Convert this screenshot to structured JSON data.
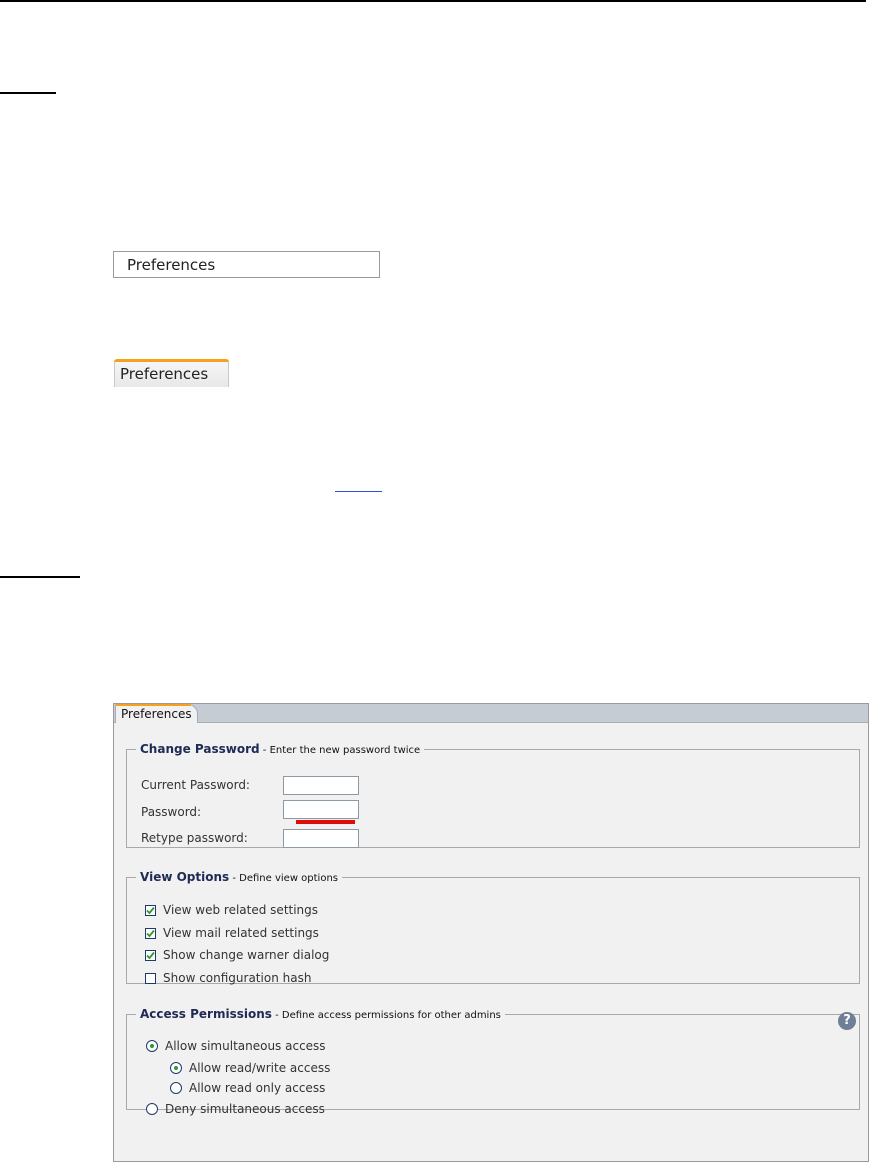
{
  "menu": {
    "label": "Preferences"
  },
  "tab": {
    "label": "Preferences"
  },
  "dialog": {
    "tab_label": "Preferences",
    "change_password": {
      "title": "Change Password",
      "subtitle": "- Enter the new password twice",
      "current_label": "Current Password:",
      "password_label": "Password:",
      "retype_label": "Retype password:",
      "current_value": "",
      "password_value": "",
      "retype_value": ""
    },
    "view_options": {
      "title": "View Options",
      "subtitle": "- Define view options",
      "items": [
        {
          "label": "View web related settings",
          "checked": true
        },
        {
          "label": "View mail related settings",
          "checked": true
        },
        {
          "label": "Show change warner dialog",
          "checked": true
        },
        {
          "label": "Show configuration hash",
          "checked": false
        }
      ]
    },
    "access_permissions": {
      "title": "Access Permissions",
      "subtitle": "- Define access permissions for other admins",
      "allow_simultaneous": "Allow simultaneous access",
      "allow_read_write": "Allow read/write access",
      "allow_read_only": "Allow read only access",
      "deny_simultaneous": "Deny simultaneous access",
      "help_label": "?"
    }
  },
  "colors": {
    "accent_tab": "#f7a11a",
    "check_color": "#2c9a2c",
    "strength_bar": "#e00b0b",
    "legend_title": "#1f2a55"
  }
}
